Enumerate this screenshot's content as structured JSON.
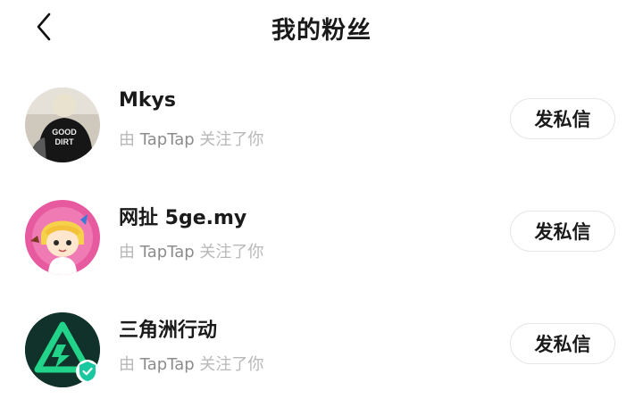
{
  "header": {
    "back_icon": "chevron-left-icon",
    "title": "我的粉丝"
  },
  "followers": [
    {
      "name": "Mkys",
      "sub_prefix": "由",
      "sub_source": "TapTap",
      "sub_suffix": "关注了你",
      "button": "发私信",
      "avatar": "photo-person-black-shirt",
      "verified": false
    },
    {
      "name": "网扯 5ge.my",
      "sub_prefix": "由",
      "sub_source": "TapTap",
      "sub_suffix": "关注了你",
      "button": "发私信",
      "avatar": "cartoon-blonde-character",
      "verified": false
    },
    {
      "name": "三角洲行动",
      "sub_prefix": "由",
      "sub_source": "TapTap",
      "sub_suffix": "关注了你",
      "button": "发私信",
      "avatar": "green-triangle-logo",
      "verified": true
    }
  ],
  "colors": {
    "verify_badge": "#19c8a0",
    "logo_green": "#22d48a",
    "avatar2_bg": "#e85aa0"
  }
}
